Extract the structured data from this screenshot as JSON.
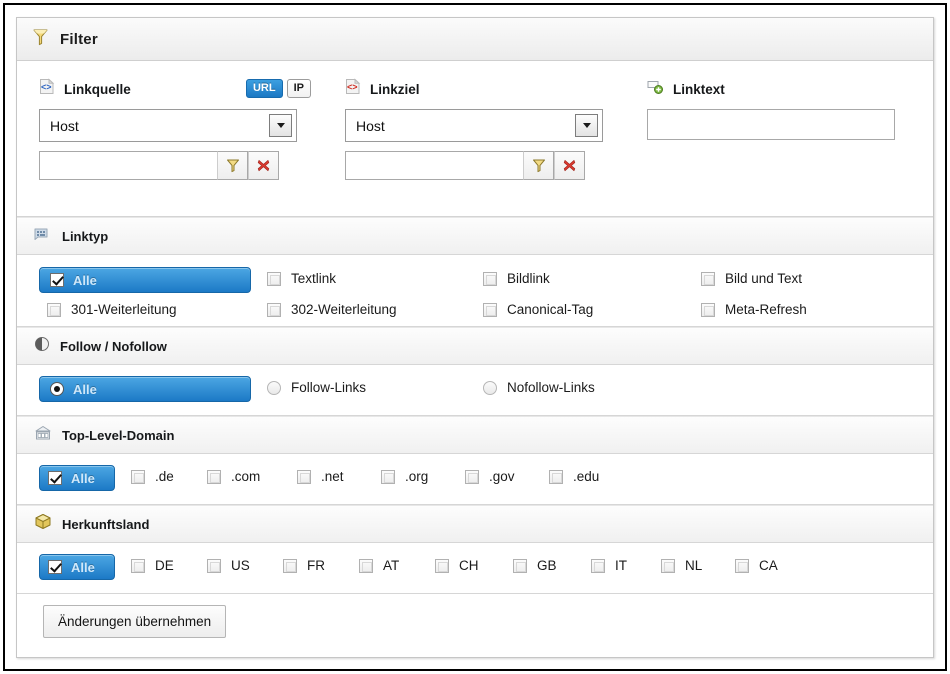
{
  "window": {
    "title": "Filter",
    "title_icon": "funnel-icon"
  },
  "top_filters": {
    "linkquelle": {
      "label": "Linkquelle",
      "icon": "code-document-blue-icon",
      "mode_buttons": [
        {
          "label": "URL",
          "active": true
        },
        {
          "label": "IP",
          "active": false
        }
      ],
      "select_value": "Host",
      "text_value": "",
      "apply_icon": "funnel-icon",
      "clear_icon": "red-x-icon"
    },
    "linkziel": {
      "label": "Linkziel",
      "icon": "code-document-red-icon",
      "select_value": "Host",
      "text_value": "",
      "apply_icon": "funnel-icon",
      "clear_icon": "red-x-icon"
    },
    "linktext": {
      "label": "Linktext",
      "icon": "textfield-add-icon",
      "text_value": ""
    }
  },
  "sections": {
    "linktyp": {
      "title": "Linktyp",
      "icon": "link-type-icon",
      "all_label": "Alle",
      "all_checked": true,
      "options": [
        {
          "label": "Textlink",
          "checked": false
        },
        {
          "label": "Bildlink",
          "checked": false
        },
        {
          "label": "Bild und Text",
          "checked": false
        },
        {
          "label": "301-Weiterleitung",
          "checked": false
        },
        {
          "label": "302-Weiterleitung",
          "checked": false
        },
        {
          "label": "Canonical-Tag",
          "checked": false
        },
        {
          "label": "Meta-Refresh",
          "checked": false
        }
      ]
    },
    "follow": {
      "title": "Follow / Nofollow",
      "icon": "half-circle-icon",
      "all_label": "Alle",
      "all_checked": true,
      "options": [
        {
          "label": "Follow-Links",
          "checked": false
        },
        {
          "label": "Nofollow-Links",
          "checked": false
        }
      ]
    },
    "tld": {
      "title": "Top-Level-Domain",
      "icon": "bank-icon",
      "all_label": "Alle",
      "all_checked": true,
      "options": [
        {
          "label": ".de",
          "checked": false
        },
        {
          "label": ".com",
          "checked": false
        },
        {
          "label": ".net",
          "checked": false
        },
        {
          "label": ".org",
          "checked": false
        },
        {
          "label": ".gov",
          "checked": false
        },
        {
          "label": ".edu",
          "checked": false
        }
      ]
    },
    "country": {
      "title": "Herkunftsland",
      "icon": "package-icon",
      "all_label": "Alle",
      "all_checked": true,
      "options": [
        {
          "label": "DE",
          "checked": false
        },
        {
          "label": "US",
          "checked": false
        },
        {
          "label": "FR",
          "checked": false
        },
        {
          "label": "AT",
          "checked": false
        },
        {
          "label": "CH",
          "checked": false
        },
        {
          "label": "GB",
          "checked": false
        },
        {
          "label": "IT",
          "checked": false
        },
        {
          "label": "NL",
          "checked": false
        },
        {
          "label": "CA",
          "checked": false
        }
      ]
    }
  },
  "footer": {
    "apply_label": "Änderungen übernehmen"
  },
  "colors": {
    "accent_blue": "#1c79c6",
    "accent_blue_light": "#4ca7e3",
    "alle_text": "#cfe8fa",
    "panel_border": "#c6c6c6",
    "red_x": "#d8352c"
  }
}
